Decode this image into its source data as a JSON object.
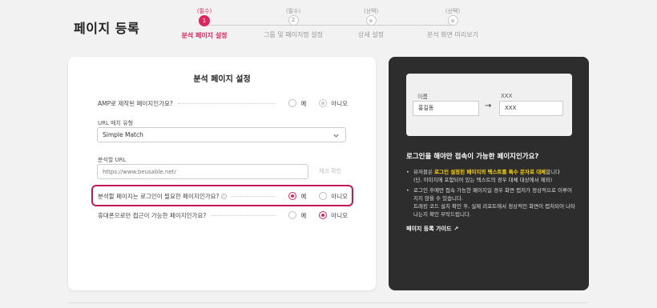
{
  "page": {
    "title": "페이지 등록"
  },
  "stepper": {
    "steps": [
      {
        "tag": "(필수)",
        "num": "1",
        "label": "분석 페이지 설정",
        "active": true
      },
      {
        "tag": "(필수)",
        "num": "2",
        "label": "그룹 및 페이지명 설정",
        "active": false
      },
      {
        "tag": "(선택)",
        "num": "",
        "label": "상세 설정",
        "active": false
      },
      {
        "tag": "(선택)",
        "num": "",
        "label": "분석 화면 미리보기",
        "active": false
      }
    ]
  },
  "form": {
    "title": "분석 페이지 설정",
    "amp": {
      "question": "AMP로 제작된 페이지인가요?",
      "yes": "예",
      "no": "아니오",
      "selected": "no"
    },
    "url_match": {
      "label": "URL 매치 유형",
      "value": "Simple Match"
    },
    "url": {
      "label": "분석할 URL",
      "placeholder": "https://www.beusable.net/",
      "check_label": "체크 확인"
    },
    "login": {
      "question": "분석할 페이지는 로그인이 필요한 페이지인가요?",
      "info": "i",
      "yes": "예",
      "no": "아니오",
      "selected": "yes"
    },
    "mobile": {
      "question": "휴대폰으로만 접근이 가능한 페이지인가요?",
      "yes": "예",
      "no": "아니오",
      "selected": "no"
    }
  },
  "panel": {
    "example": {
      "name_label": "이름",
      "name_value": "홍길동",
      "arrow": "→",
      "masked_label": "XXX",
      "masked_value": "XXX"
    },
    "heading": "로그인을 해야만 접속이 가능한 페이지인가요?",
    "bullet1_a": "뷰저블은 ",
    "bullet1_hl": "로그인 설정된 페이지의 텍스트를 특수 문자로 대체",
    "bullet1_b": "합니다",
    "bullet1_c": "(단, 이미지에 포함되어 있는 텍스트의 경우 대체 대상에서 제외)",
    "bullet2_a": "로그인 후에만 접속 가능한 페이지일 경우 화면 캡처가 정상적으로 이루어지지 않을 수 있습니다.",
    "bullet2_b": "트래킹 코드 설치 확인 후, 실제 리포트에서 정상적인 화면이 캡처되어 나타나는지 확인 부탁드립니다.",
    "guide_label": "페이지 등록 가이드",
    "guide_icon": "↗"
  },
  "colors": {
    "accent": "#e0245e",
    "highlight_border": "#c2185b",
    "panel_bg": "#2d2d2d",
    "yellow": "#ffd400"
  }
}
